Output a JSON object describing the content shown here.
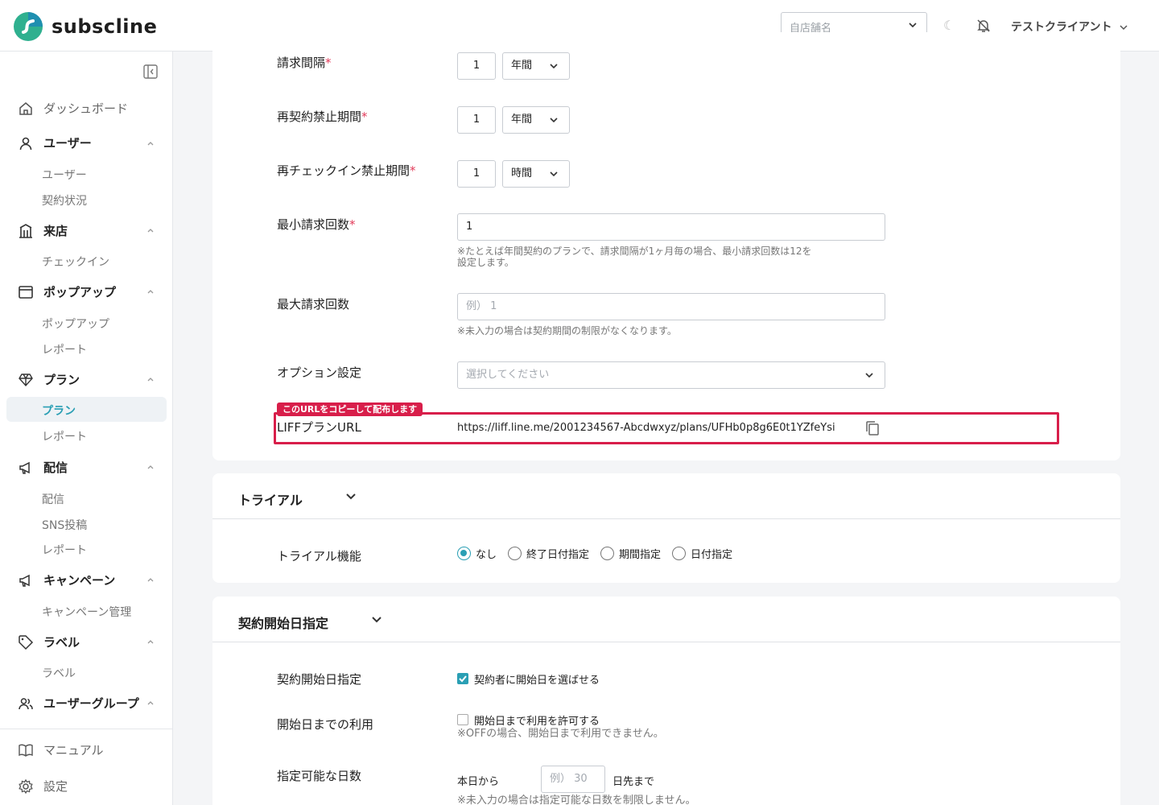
{
  "app": {
    "name": "subscline"
  },
  "header": {
    "store_placeholder": "自店舗名",
    "moon": "☾",
    "client_name": "テストクライアント"
  },
  "sidebar": {
    "dashboard": "ダッシュボード",
    "users": {
      "label": "ユーザー",
      "items": [
        "ユーザー",
        "契約状況"
      ]
    },
    "visit": {
      "label": "来店",
      "items": [
        "チェックイン"
      ]
    },
    "popup": {
      "label": "ポップアップ",
      "items": [
        "ポップアップ",
        "レポート"
      ]
    },
    "plan": {
      "label": "プラン",
      "items": [
        "プラン",
        "レポート"
      ]
    },
    "delivery": {
      "label": "配信",
      "items": [
        "配信",
        "SNS投稿",
        "レポート"
      ]
    },
    "campaign": {
      "label": "キャンペーン",
      "items": [
        "キャンペーン管理"
      ]
    },
    "label": {
      "label": "ラベル",
      "items": [
        "ラベル"
      ]
    },
    "user_group": {
      "label": "ユーザーグループ"
    },
    "manual": "マニュアル",
    "settings": "設定"
  },
  "form": {
    "billing_interval": {
      "label": "請求間隔",
      "value": "1",
      "unit": "年間"
    },
    "recontract_ban": {
      "label": "再契約禁止期間",
      "value": "1",
      "unit": "年間"
    },
    "recheckin_ban": {
      "label": "再チェックイン禁止期間",
      "value": "1",
      "unit": "時間"
    },
    "min_billing": {
      "label": "最小請求回数",
      "value": "1",
      "hint_line1": "※たとえば年間契約のプランで、請求間隔が1ヶ月毎の場合、最小請求回数は12を",
      "hint_line2": "設定します。"
    },
    "max_billing": {
      "label": "最大請求回数",
      "placeholder": "例） 1",
      "hint": "※未入力の場合は契約期間の制限がなくなります。"
    },
    "options": {
      "label": "オプション設定",
      "placeholder": "選択してください"
    },
    "liff_url": {
      "badge": "このURLをコピーして配布します",
      "label": "LIFFプランURL",
      "value": "https://liff.line.me/2001234567-Abcdwxyz/plans/UFHb0p8g6E0t1YZfeYsi"
    },
    "required_mark": "*"
  },
  "trial": {
    "title": "トライアル",
    "feature_label": "トライアル機能",
    "options": [
      "なし",
      "終了日付指定",
      "期間指定",
      "日付指定"
    ],
    "selected": "なし"
  },
  "contract_start": {
    "title": "契約開始日指定",
    "row1": {
      "label": "契約開始日指定",
      "checkbox": "契約者に開始日を選ばせる",
      "checked": true
    },
    "row2": {
      "label": "開始日までの利用",
      "checkbox": "開始日まで利用を許可する",
      "checked": false,
      "hint": "※OFFの場合、開始日まで利用できません。"
    },
    "row3": {
      "label": "指定可能な日数",
      "prefix": "本日から",
      "placeholder": "例） 30",
      "suffix": "日先まで",
      "hint": "※未入力の場合は指定可能な日数を制限しません。"
    }
  },
  "colors": {
    "accent": "#2a9fb4",
    "highlight": "#d81e4a",
    "required": "#e23b5a"
  }
}
